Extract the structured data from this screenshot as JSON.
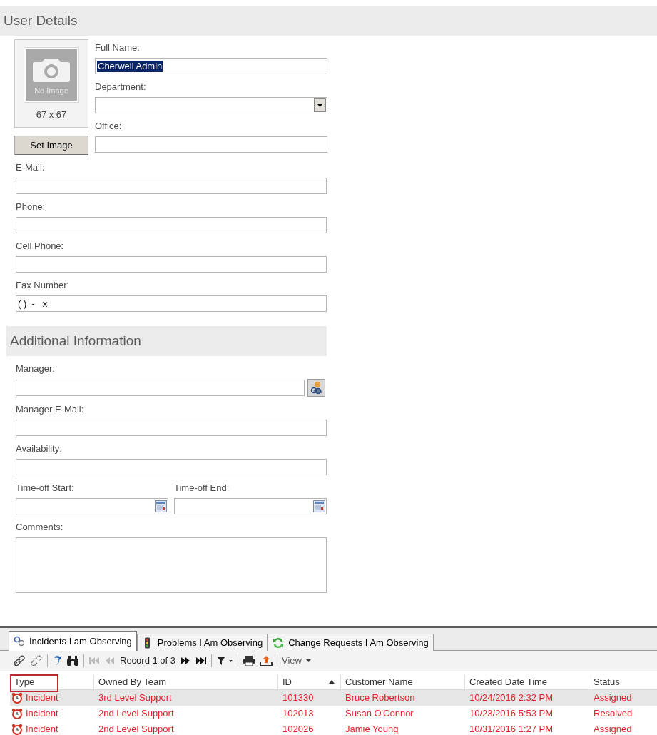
{
  "user_details": {
    "title": "User Details",
    "image": {
      "placeholder_text": "No Image",
      "size": "67 x 67"
    },
    "set_image_button": "Set Image",
    "side_fields": [
      {
        "label": "Full Name:",
        "kind": "text",
        "value": "Cherwell Admin",
        "text_selected": true
      },
      {
        "label": "Department:",
        "kind": "dropdown"
      },
      {
        "label": "Office:",
        "kind": "text"
      }
    ],
    "fields": [
      {
        "label": "E-Mail:",
        "kind": "text"
      },
      {
        "label": "Phone:",
        "kind": "text"
      },
      {
        "label": "Cell Phone:",
        "kind": "text"
      },
      {
        "label": "Fax Number:",
        "kind": "text",
        "value": "( )  -   x"
      }
    ]
  },
  "additional_information": {
    "title": "Additional Information",
    "fields": [
      {
        "label": "Manager:",
        "kind": "lookup"
      },
      {
        "label": "Manager  E-Mail:",
        "kind": "text"
      },
      {
        "label": "Availability:",
        "kind": "text"
      },
      {
        "kind": "date_pair",
        "items": [
          {
            "label": "Time-off Start:"
          },
          {
            "label": "Time-off End:"
          }
        ]
      },
      {
        "label": "Comments:",
        "kind": "textarea"
      }
    ]
  },
  "observing": {
    "tabs": [
      {
        "label": "Incidents I am Observing",
        "selected": true
      },
      {
        "label": "Problems I Am Observing",
        "selected": false
      },
      {
        "label": "Change Requests I Am Observing",
        "selected": false
      }
    ],
    "toolbar": {
      "record": "Record 1 of 3",
      "view": "View"
    },
    "table": {
      "columns": [
        {
          "label": "Type",
          "sorted": false
        },
        {
          "label": "Owned By Team",
          "sorted": false
        },
        {
          "label": "ID",
          "sorted": true
        },
        {
          "label": "Customer Name",
          "sorted": false
        },
        {
          "label": "Created Date Time",
          "sorted": false
        },
        {
          "label": "Status",
          "sorted": false
        }
      ],
      "rows": [
        {
          "selected": true,
          "cells": [
            "Incident",
            "3rd Level Support",
            "101330",
            "Bruce Robertson",
            "10/24/2016 2:32 PM",
            "Assigned"
          ]
        },
        {
          "selected": false,
          "cells": [
            "Incident",
            "2nd Level Support",
            "102013",
            "Susan O'Connor",
            "10/23/2016 5:53 PM",
            "Resolved"
          ]
        },
        {
          "selected": false,
          "cells": [
            "Incident",
            "2nd Level Support",
            "102026",
            "Jamie Young",
            "10/31/2016 1:27 PM",
            "Assigned"
          ]
        }
      ]
    }
  }
}
